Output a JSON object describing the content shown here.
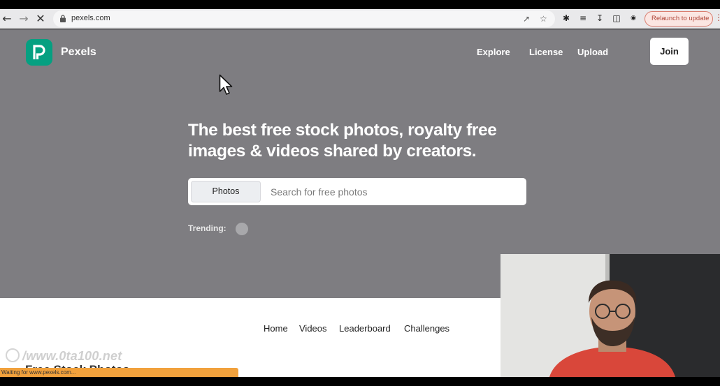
{
  "browser": {
    "url": "pexels.com",
    "relaunch_label": "Relaunch to update",
    "status_text": "Waiting for www.pexels.com..."
  },
  "header": {
    "brand": "Pexels",
    "nav": [
      "Explore",
      "License",
      "Upload"
    ],
    "join_label": "Join"
  },
  "hero": {
    "headline_line1": "The best free stock photos, royalty free",
    "headline_line2": "images & videos shared by creators.",
    "search_type": "Photos",
    "search_placeholder": "Search for free photos",
    "trending_label": "Trending:"
  },
  "subnav": [
    "Home",
    "Videos",
    "Leaderboard",
    "Challenges"
  ],
  "partial_heading": "Free Stock Photos",
  "watermark": "/www.0ta100.net",
  "colors": {
    "hero_bg": "#7e7d81",
    "brand_green": "#05a081",
    "status_bar": "#f1a13c",
    "relaunch_text": "#b0473a"
  }
}
